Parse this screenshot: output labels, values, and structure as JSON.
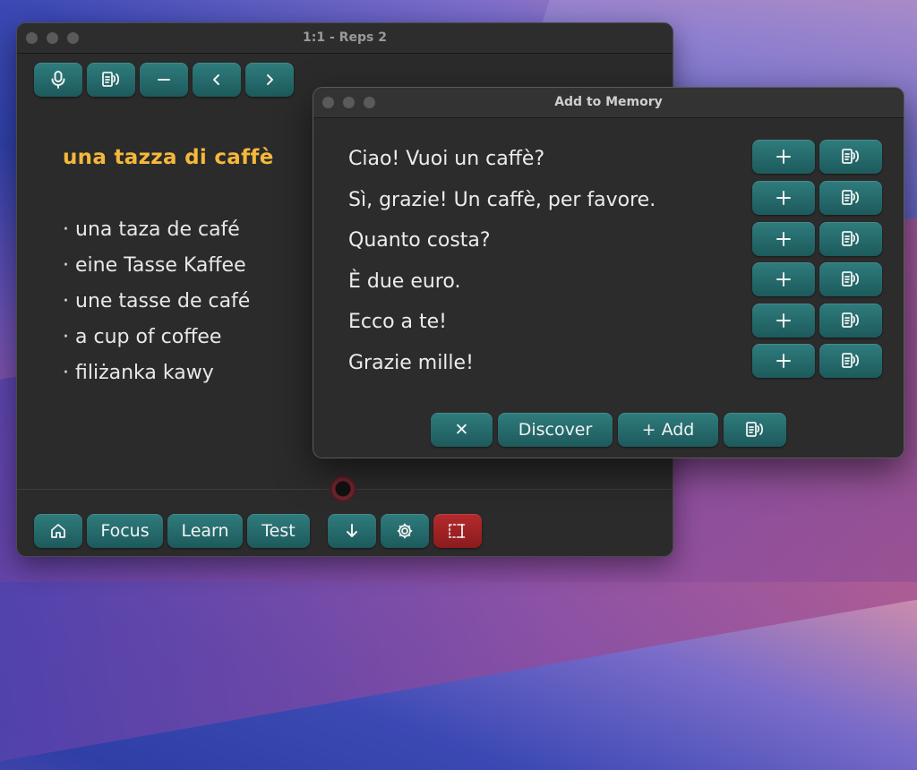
{
  "main_window": {
    "title": "1:1 - Reps 2",
    "lesson_title": "una tazza di caffè",
    "translations": [
      "una taza de café",
      "eine Tasse Kaffee",
      "une tasse de café",
      "a cup of coffee",
      "filiżanka kawy"
    ],
    "bottom_toolbar": {
      "focus_label": "Focus",
      "learn_label": "Learn",
      "test_label": "Test"
    }
  },
  "dialog": {
    "title": "Add to Memory",
    "phrases": [
      "Ciao! Vuoi un caffè?",
      "Sì, grazie! Un caffè, per favore.",
      "Quanto costa?",
      "È due euro.",
      "Ecco a te!",
      "Grazie mille!"
    ],
    "footer": {
      "close_label": "✕",
      "discover_label": "Discover",
      "add_label": "+ Add"
    }
  },
  "icons": {
    "microphone": "microphone-icon",
    "speak": "speak-icon",
    "minus": "minus-icon",
    "prev": "chevron-left-icon",
    "next": "chevron-right-icon",
    "plus": "plus-icon",
    "home": "home-icon",
    "down": "arrow-down-icon",
    "settings": "gear-icon",
    "select": "text-selection-icon"
  },
  "colors": {
    "button_teal": "#25696b",
    "lesson_title": "#f5b83a",
    "record_red": "#a02326"
  }
}
